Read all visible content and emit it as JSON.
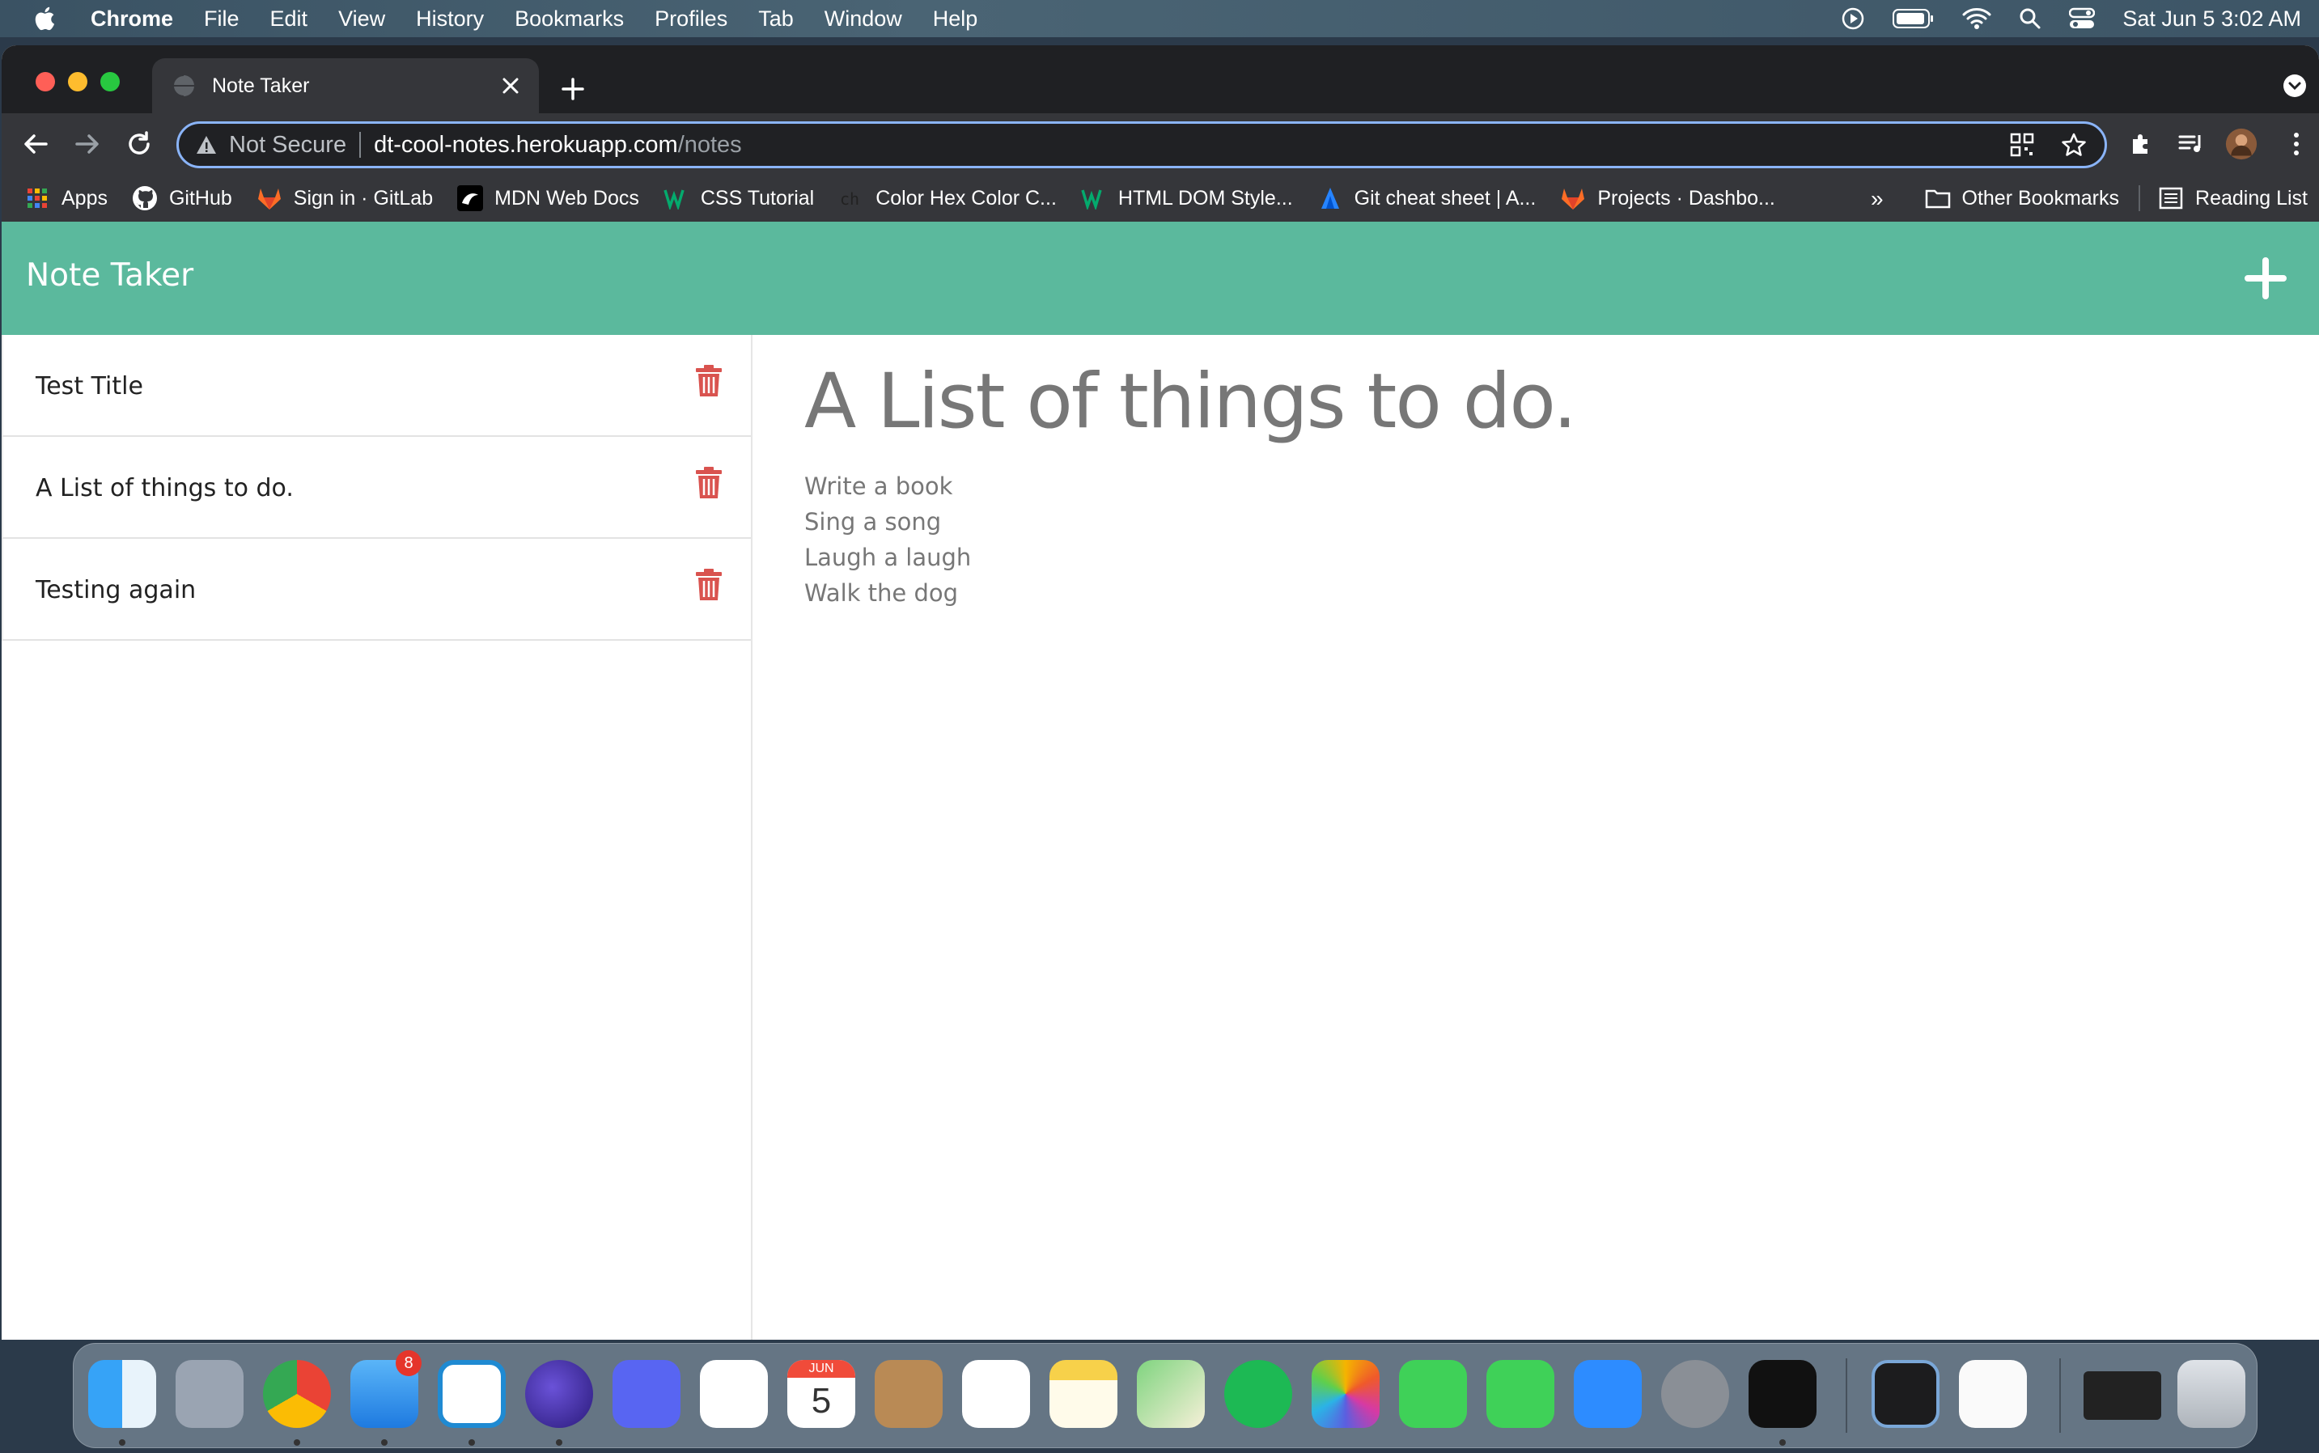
{
  "menubar": {
    "app_name": "Chrome",
    "items": [
      "File",
      "Edit",
      "View",
      "History",
      "Bookmarks",
      "Profiles",
      "Tab",
      "Window",
      "Help"
    ],
    "clock": "Sat Jun 5  3:02 AM"
  },
  "browser": {
    "tab_title": "Note Taker",
    "address": {
      "security_label": "Not Secure",
      "host": "dt-cool-notes.herokuapp.com",
      "path": "/notes"
    },
    "bookmarks": [
      {
        "label": "Apps",
        "icon": "apps-grid-icon"
      },
      {
        "label": "GitHub",
        "icon": "github-icon"
      },
      {
        "label": "Sign in · GitLab",
        "icon": "gitlab-icon"
      },
      {
        "label": "MDN Web Docs",
        "icon": "mdn-icon"
      },
      {
        "label": "CSS Tutorial",
        "icon": "w3schools-icon"
      },
      {
        "label": "Color Hex Color C...",
        "icon": "colorhex-icon"
      },
      {
        "label": "HTML DOM Style...",
        "icon": "w3schools-icon"
      },
      {
        "label": "Git cheat sheet | A...",
        "icon": "atlassian-icon"
      },
      {
        "label": "Projects · Dashbo...",
        "icon": "gitlab-icon"
      }
    ],
    "overflow_label": "»",
    "other_bookmarks": "Other Bookmarks",
    "reading_list": "Reading List"
  },
  "app": {
    "brand": "Note Taker",
    "accent_color": "#5bb99d",
    "delete_color": "#d9534f",
    "notes": [
      {
        "title": "Test Title"
      },
      {
        "title": "A List of things to do."
      },
      {
        "title": "Testing again"
      }
    ],
    "active_note": {
      "title": "A List of things to do.",
      "body": "Write a book\nSing a song\nLaugh a laugh\nWalk the dog"
    }
  },
  "dock": {
    "apps": [
      "Finder",
      "Launchpad",
      "Chrome",
      "Mail",
      "VS Code",
      "Nightly",
      "Discord",
      "Slack",
      "Calendar",
      "Contacts",
      "Reminders",
      "Notes",
      "Maps",
      "Spotify",
      "Photos",
      "Messages",
      "FaceTime",
      "Zoom",
      "System Preferences",
      "Terminal",
      "QuickTime",
      "TextEdit",
      "Window Preview",
      "Trash"
    ],
    "mail_badge": "8",
    "calendar_month": "JUN",
    "calendar_day": "5"
  }
}
